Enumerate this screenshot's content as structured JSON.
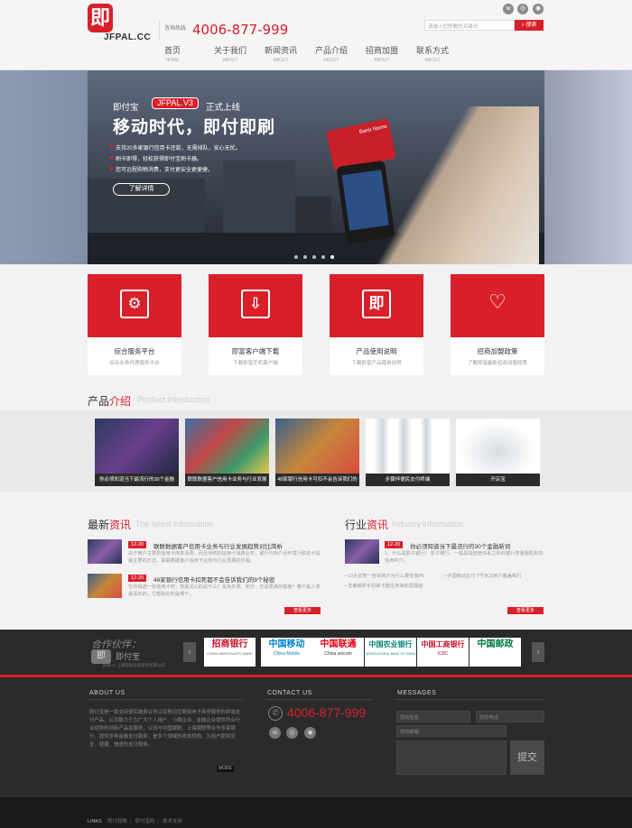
{
  "header": {
    "logo_char": "即",
    "logo_text": "JFPAL.CC",
    "hotline_label": "咨询热线",
    "phone": "4006-877-999",
    "search_placeholder": "请输入您想要的关键词",
    "search_button": "搜索",
    "social_icons": [
      "weibo-icon",
      "wechat-icon",
      "qq-icon"
    ]
  },
  "nav": {
    "items": [
      {
        "cn": "首页",
        "en": "HOME"
      },
      {
        "cn": "关于我们",
        "en": "ABOUT"
      },
      {
        "cn": "新闻资讯",
        "en": "ABOUT"
      },
      {
        "cn": "产品介绍",
        "en": "ABOUT"
      },
      {
        "cn": "招商加盟",
        "en": "ABOUT"
      },
      {
        "cn": "联系方式",
        "en": "ABOUT"
      }
    ]
  },
  "banner": {
    "prefix": "即付宝",
    "tag": "JFPAL.V3",
    "suffix": "正式上线",
    "title": "移动时代，即付即刷",
    "bullets": [
      "支持20多家银行信用卡还款，无需排队，安心无忧。",
      "刷卡即得，轻松获得即付宝刷卡器。",
      "您可远程购物消费，支付更安全更便捷。"
    ],
    "button": "了解详情",
    "card_text": "Bank Name",
    "slide_count": 5,
    "active_slide": 5
  },
  "services": [
    {
      "icon": "monitor-gear-icon",
      "title": "综合服务平台",
      "sub": "综合业务代理服务平台"
    },
    {
      "icon": "download-icon",
      "title": "即富客户端下载",
      "sub": "下载即富手机客户端"
    },
    {
      "icon": "jfpal-logo-icon",
      "title": "产品使用说明",
      "sub": "下载即富产品使用说明"
    },
    {
      "icon": "handshake-icon",
      "title": "招商加盟政策",
      "sub": "了解即富最新招商加盟政策"
    }
  ],
  "products": {
    "title_a": "产品",
    "title_b": "介绍",
    "title_en": "Product introduction",
    "items": [
      "你必须知道当下最流行的30个金融",
      "联联数据客户信用卡业务与行业发展",
      "48家银行信用卡可扣不会告诉我们的",
      "步骤伴便民支付终端",
      "开店宝"
    ]
  },
  "latest": {
    "title_a": "最新",
    "title_b": "资讯",
    "title_en": "The latest information",
    "items": [
      {
        "date": "12-20",
        "headline": "联联数据客户信用卡业务与行业发展趋势对比简析",
        "body": "由于用户主要把信用卡用来消费，而且传统的信用卡消费业务，银行与商户合作发行联名卡是最主要的方式，联联数据客户信用卡业务与行业发展的历程。"
      },
      {
        "date": "12-20",
        "headline": "48家银行信用卡扣死都不会告诉我们的9个秘密",
        "body": "在你挑选一张信用卡时，你最关心的是什么？是免年费、积分，还是更高的额度？哪个是人类最喜欢的，它帮助你的是哪个。"
      }
    ],
    "more": "查看更多"
  },
  "industry": {
    "title_a": "行业",
    "title_b": "资讯",
    "title_en": "Industry information",
    "top": {
      "date": "12-20",
      "headline": "你必须知道当下最流行的30个金融新词",
      "body": "1、什么是影子银行？ 影子银行，一般是指监管体系之外的银行类金融机构的信用中介。"
    },
    "list": [
      "10大优势一告诉商户为什么要安装P0",
      "中国移动支付 7千米次用户覆盖和行",
      "苏度解析手机刷卡器在未来的发展趋"
    ],
    "more": "查看更多"
  },
  "partners": {
    "title": "合作伙伴：",
    "brand_char": "即",
    "brand_name": "即付宝",
    "brand_sub": "jfpal.cc 上海即富信息技术有限公司",
    "logos": [
      {
        "name": "招商银行",
        "en": "CHINA MERCHANTS BANK",
        "color": "#c8102e"
      },
      {
        "name": "中国移动",
        "en": "China Mobile",
        "color": "#0085d0"
      },
      {
        "name": "中国联通",
        "en": "China unicom",
        "color": "#e60012"
      },
      {
        "name": "中国农业银行",
        "en": "AGRICULTURAL BANK OF CHINA",
        "color": "#008574"
      },
      {
        "name": "中国工商银行",
        "en": "ICBC",
        "color": "#c8102e"
      },
      {
        "name": "中国邮政",
        "en": "",
        "color": "#007a3d"
      }
    ]
  },
  "footer": {
    "about_title": "ABOUT US",
    "about_text": "即付宝是一款支持便民缴费业务以及移动互联网电子商务服务的终端支付产品，公司致力于为广大个人用户、小微企业、金融企业提供符合行业趋势的创新产品及服务，公司与中国银联、上海银联等合作多家银行，提供多种金融支付服务，是多个领域的收单机构，为用户提供安全、便捷、快速的支付服务。",
    "more": "MORE",
    "contact_title": "CONTACT US",
    "phone": "4006-877-999",
    "messages_title": "MESSAGES",
    "name_placeholder": "您的姓名",
    "phone_placeholder": "您的电话",
    "email_placeholder": "您的邮箱",
    "submit": "提交",
    "links_label": "LINKS",
    "links": [
      "即付即刷",
      "即付宝网",
      "技术支持"
    ]
  },
  "colors": {
    "accent": "#d9202a",
    "dark": "#2b2b2b"
  }
}
